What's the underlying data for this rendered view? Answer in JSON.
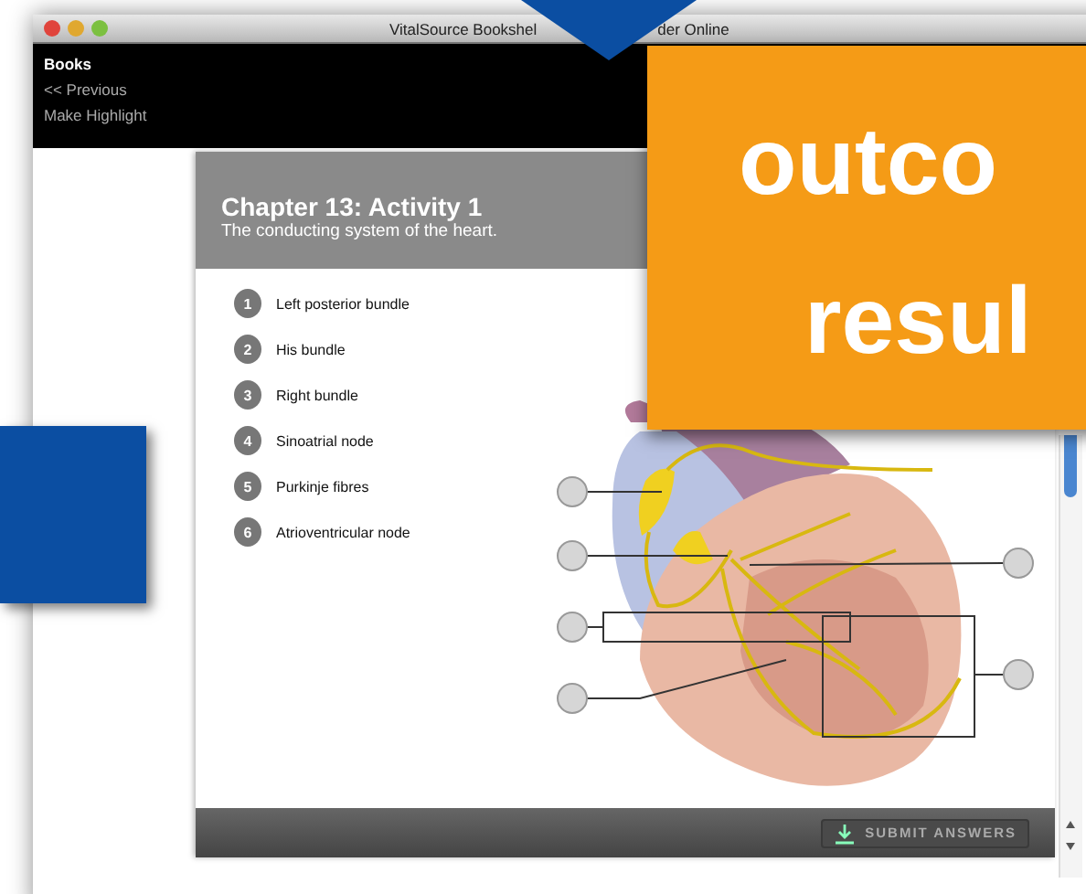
{
  "window": {
    "title_start": "VitalSource Bookshel",
    "title_end": "der Online"
  },
  "toolbar": {
    "heading": "Books",
    "links": [
      "<< Previous",
      "Make Highlight"
    ]
  },
  "activity": {
    "title": "Chapter 13: Activity 1",
    "subtitle": "The conducting system of the heart.",
    "terms": [
      {
        "number": "1",
        "label": "Left posterior bundle"
      },
      {
        "number": "2",
        "label": "His bundle"
      },
      {
        "number": "3",
        "label": "Right bundle"
      },
      {
        "number": "4",
        "label": "Sinoatrial node"
      },
      {
        "number": "5",
        "label": "Purkinje fibres"
      },
      {
        "number": "6",
        "label": "Atrioventricular node"
      }
    ],
    "submit": "SUBMIT ANSWERS"
  },
  "overlay": {
    "lines": [
      "outco",
      "resul"
    ]
  }
}
